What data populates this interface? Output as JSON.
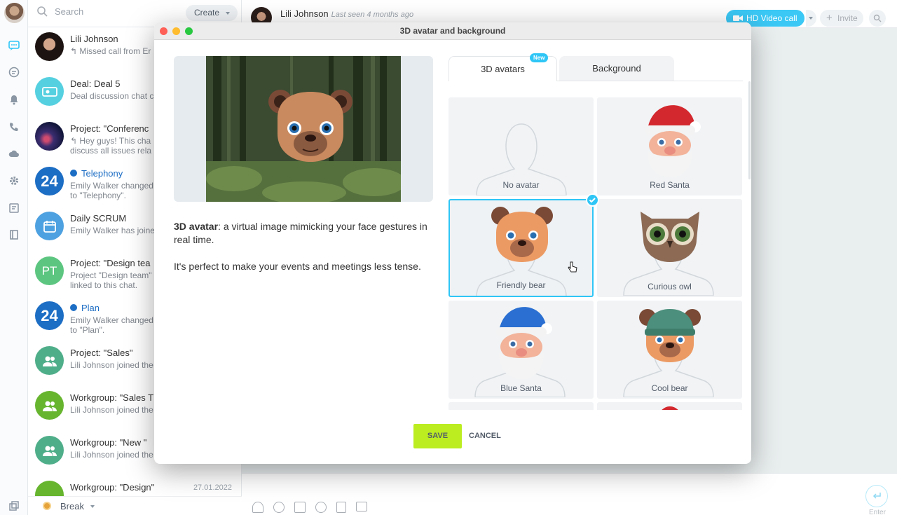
{
  "sidebar": {
    "search_placeholder": "Search",
    "create_label": "Create",
    "status_label": "Break"
  },
  "chats": [
    {
      "name": "Lili Johnson",
      "preview": "Missed call from Er",
      "date": ""
    },
    {
      "name": "Deal: Deal 5",
      "preview": "Deal discussion chat c",
      "date": ""
    },
    {
      "name": "Project: \"Conferenc",
      "preview": "Hey guys! This cha discuss all issues rela",
      "date": ""
    },
    {
      "name": "Telephony",
      "preview": "Emily Walker changed to \"Telephony\".",
      "date": ""
    },
    {
      "name": "Daily SCRUM",
      "preview": "Emily Walker has joine",
      "date": ""
    },
    {
      "name": "Project: \"Design tea",
      "preview": "Project \"Design team\" linked to this chat.",
      "date": "",
      "initials": "PT"
    },
    {
      "name": "Plan",
      "preview": "Emily Walker changed to \"Plan\".",
      "date": ""
    },
    {
      "name": "Project: \"Sales\"",
      "preview": "Lili Johnson joined the",
      "date": ""
    },
    {
      "name": "Workgroup: \"Sales T",
      "preview": "Lili Johnson joined the",
      "date": ""
    },
    {
      "name": "Workgroup: \"New \"",
      "preview": "Lili Johnson joined the",
      "date": ""
    },
    {
      "name": "Workgroup: \"Design\"",
      "preview": "",
      "date": "27.01.2022"
    }
  ],
  "header": {
    "contact_name": "Lili Johnson",
    "last_seen": "Last seen 4 months ago",
    "video_call_label": "HD Video call",
    "invite_label": "Invite"
  },
  "composer": {
    "send_hint": "Enter"
  },
  "modal": {
    "title": "3D avatar and background",
    "desc_bold": "3D avatar",
    "desc_rest": ": a virtual image mimicking your face gestures in real time.",
    "desc_2": "It's perfect to make your events and meetings less tense.",
    "tabs": [
      {
        "label": "3D avatars",
        "badge": "New"
      },
      {
        "label": "Background"
      }
    ],
    "avatars": [
      {
        "label": "No avatar",
        "selected": false
      },
      {
        "label": "Red Santa",
        "selected": false
      },
      {
        "label": "Friendly bear",
        "selected": true
      },
      {
        "label": "Curious owl",
        "selected": false
      },
      {
        "label": "Blue Santa",
        "selected": false
      },
      {
        "label": "Cool bear",
        "selected": false
      }
    ],
    "save_label": "SAVE",
    "cancel_label": "CANCEL"
  },
  "colors": {
    "accent": "#2fc6f6",
    "save_button": "#bbed21",
    "telephony_blue": "#1c6dc4"
  }
}
